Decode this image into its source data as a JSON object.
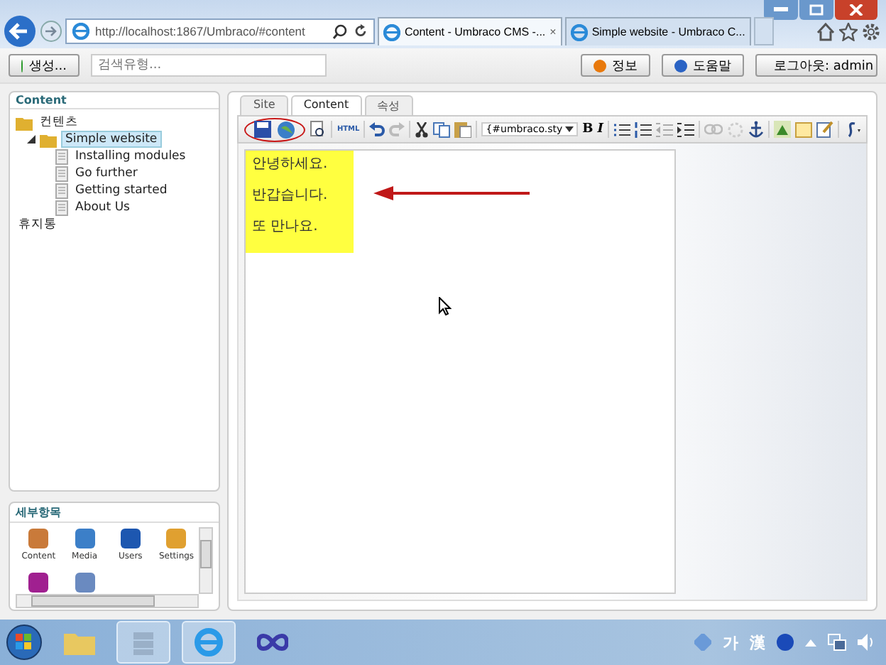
{
  "browser": {
    "address": "http://localhost:1867/Umbraco/#content",
    "tabs": [
      {
        "title": "Content - Umbraco CMS -...",
        "selected": true
      },
      {
        "title": "Simple website - Umbraco C...",
        "selected": false
      }
    ],
    "close_glyph": "×"
  },
  "app_bar": {
    "create_button": "생성...",
    "search": {
      "placeholder": "검색유형..."
    },
    "buttons": [
      {
        "label": "정보",
        "kind": "info"
      },
      {
        "label": "도움말",
        "kind": "help"
      },
      {
        "label": "로그아웃: admin",
        "kind": "logout"
      }
    ]
  },
  "tree": {
    "title": "Content",
    "items": [
      {
        "label": "컨텐츠",
        "kind": "folder",
        "selected": false,
        "expanded": true,
        "children": [
          {
            "label": "Simple website",
            "kind": "folder",
            "selected": true,
            "expanded": true,
            "children": [
              {
                "label": "Installing modules",
                "kind": "page",
                "selected": false
              },
              {
                "label": "Go further",
                "kind": "page",
                "selected": false
              },
              {
                "label": "Getting started",
                "kind": "page",
                "selected": false
              },
              {
                "label": "About Us",
                "kind": "page",
                "selected": false
              }
            ]
          }
        ]
      },
      {
        "label": "휴지통",
        "kind": "trash",
        "selected": false
      }
    ]
  },
  "sections": {
    "title": "세부항목",
    "items": [
      {
        "label": "Content",
        "kind": "content"
      },
      {
        "label": "Media",
        "kind": "media"
      },
      {
        "label": "Users",
        "kind": "users"
      },
      {
        "label": "Settings",
        "kind": "settings"
      },
      {
        "kind": "pen"
      },
      {
        "kind": "card"
      }
    ]
  },
  "editor": {
    "tabs": [
      {
        "label": "Site",
        "selected": false
      },
      {
        "label": "Content",
        "selected": true
      },
      {
        "label": "속성",
        "selected": false
      }
    ],
    "toolbar": {
      "html": "HTML",
      "style_select": "{#umbraco.sty",
      "bold": "B",
      "italic": "I"
    },
    "lines": [
      "안녕하세요.",
      "반갑습니다.",
      "또 만나요."
    ]
  },
  "taskbar": {
    "ime": [
      "가",
      "漢"
    ]
  }
}
